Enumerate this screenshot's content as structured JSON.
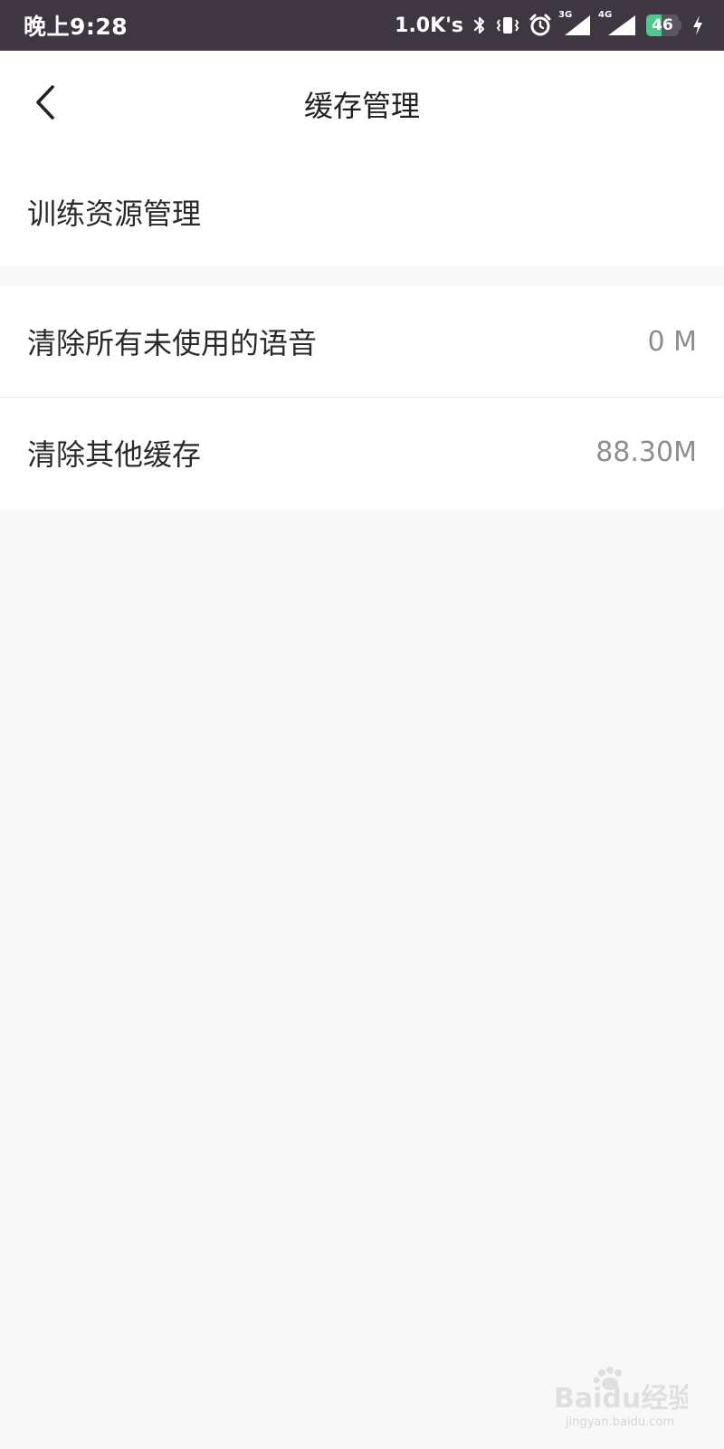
{
  "status_bar": {
    "time": "晚上9:28",
    "net_speed": "1.0K's",
    "signal_1_label": "3G",
    "signal_2_label": "4G",
    "battery_level": "46",
    "battery_percent": 46,
    "icons": [
      "bluetooth-icon",
      "vibrate-icon",
      "alarm-icon",
      "signal-3g-icon",
      "signal-4g-icon",
      "battery-icon",
      "charging-icon"
    ]
  },
  "header": {
    "title": "缓存管理"
  },
  "sections": [
    {
      "rows": [
        {
          "label": "训练资源管理"
        }
      ]
    },
    {
      "rows": [
        {
          "label": "清除所有未使用的语音",
          "value": "0 M"
        },
        {
          "label": "清除其他缓存",
          "value": "88.30M"
        }
      ]
    }
  ],
  "watermark": {
    "logo_text": "Baidu经验",
    "sub_text": "jingyan.baidu.com"
  },
  "colors": {
    "status_bar_bg": "#3e3742",
    "page_bg": "#f8f8f8",
    "card_bg": "#ffffff",
    "battery_fill": "#4cc98b"
  }
}
